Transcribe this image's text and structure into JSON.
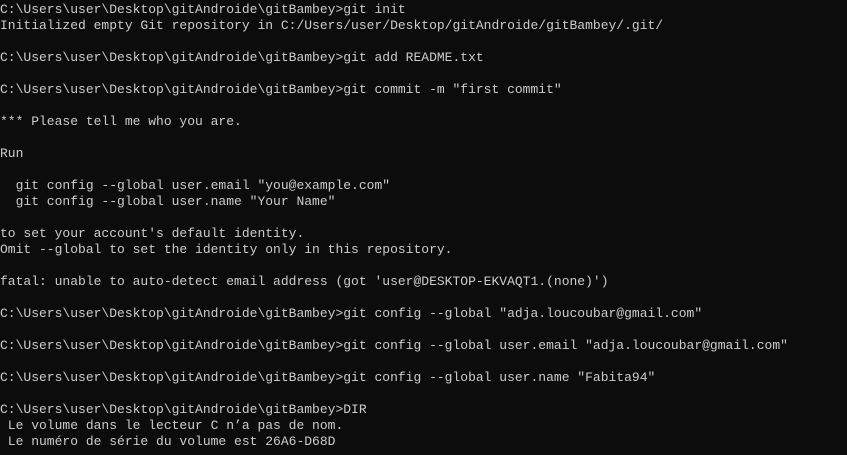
{
  "terminal": {
    "colors": {
      "background": "#0c0c0c",
      "foreground": "#cccccc"
    },
    "lines": [
      "C:\\Users\\user\\Desktop\\gitAndroide\\gitBambey>git init",
      "Initialized empty Git repository in C:/Users/user/Desktop/gitAndroide/gitBambey/.git/",
      "",
      "C:\\Users\\user\\Desktop\\gitAndroide\\gitBambey>git add README.txt",
      "",
      "C:\\Users\\user\\Desktop\\gitAndroide\\gitBambey>git commit -m \"first commit\"",
      "",
      "*** Please tell me who you are.",
      "",
      "Run",
      "",
      "  git config --global user.email \"you@example.com\"",
      "  git config --global user.name \"Your Name\"",
      "",
      "to set your account's default identity.",
      "Omit --global to set the identity only in this repository.",
      "",
      "fatal: unable to auto-detect email address (got 'user@DESKTOP-EKVAQT1.(none)')",
      "",
      "C:\\Users\\user\\Desktop\\gitAndroide\\gitBambey>git config --global \"adja.loucoubar@gmail.com\"",
      "",
      "C:\\Users\\user\\Desktop\\gitAndroide\\gitBambey>git config --global user.email \"adja.loucoubar@gmail.com\"",
      "",
      "C:\\Users\\user\\Desktop\\gitAndroide\\gitBambey>git config --global user.name \"Fabita94\"",
      "",
      "C:\\Users\\user\\Desktop\\gitAndroide\\gitBambey>DIR",
      " Le volume dans le lecteur C n’a pas de nom.",
      " Le numéro de série du volume est 26A6-D68D"
    ]
  }
}
